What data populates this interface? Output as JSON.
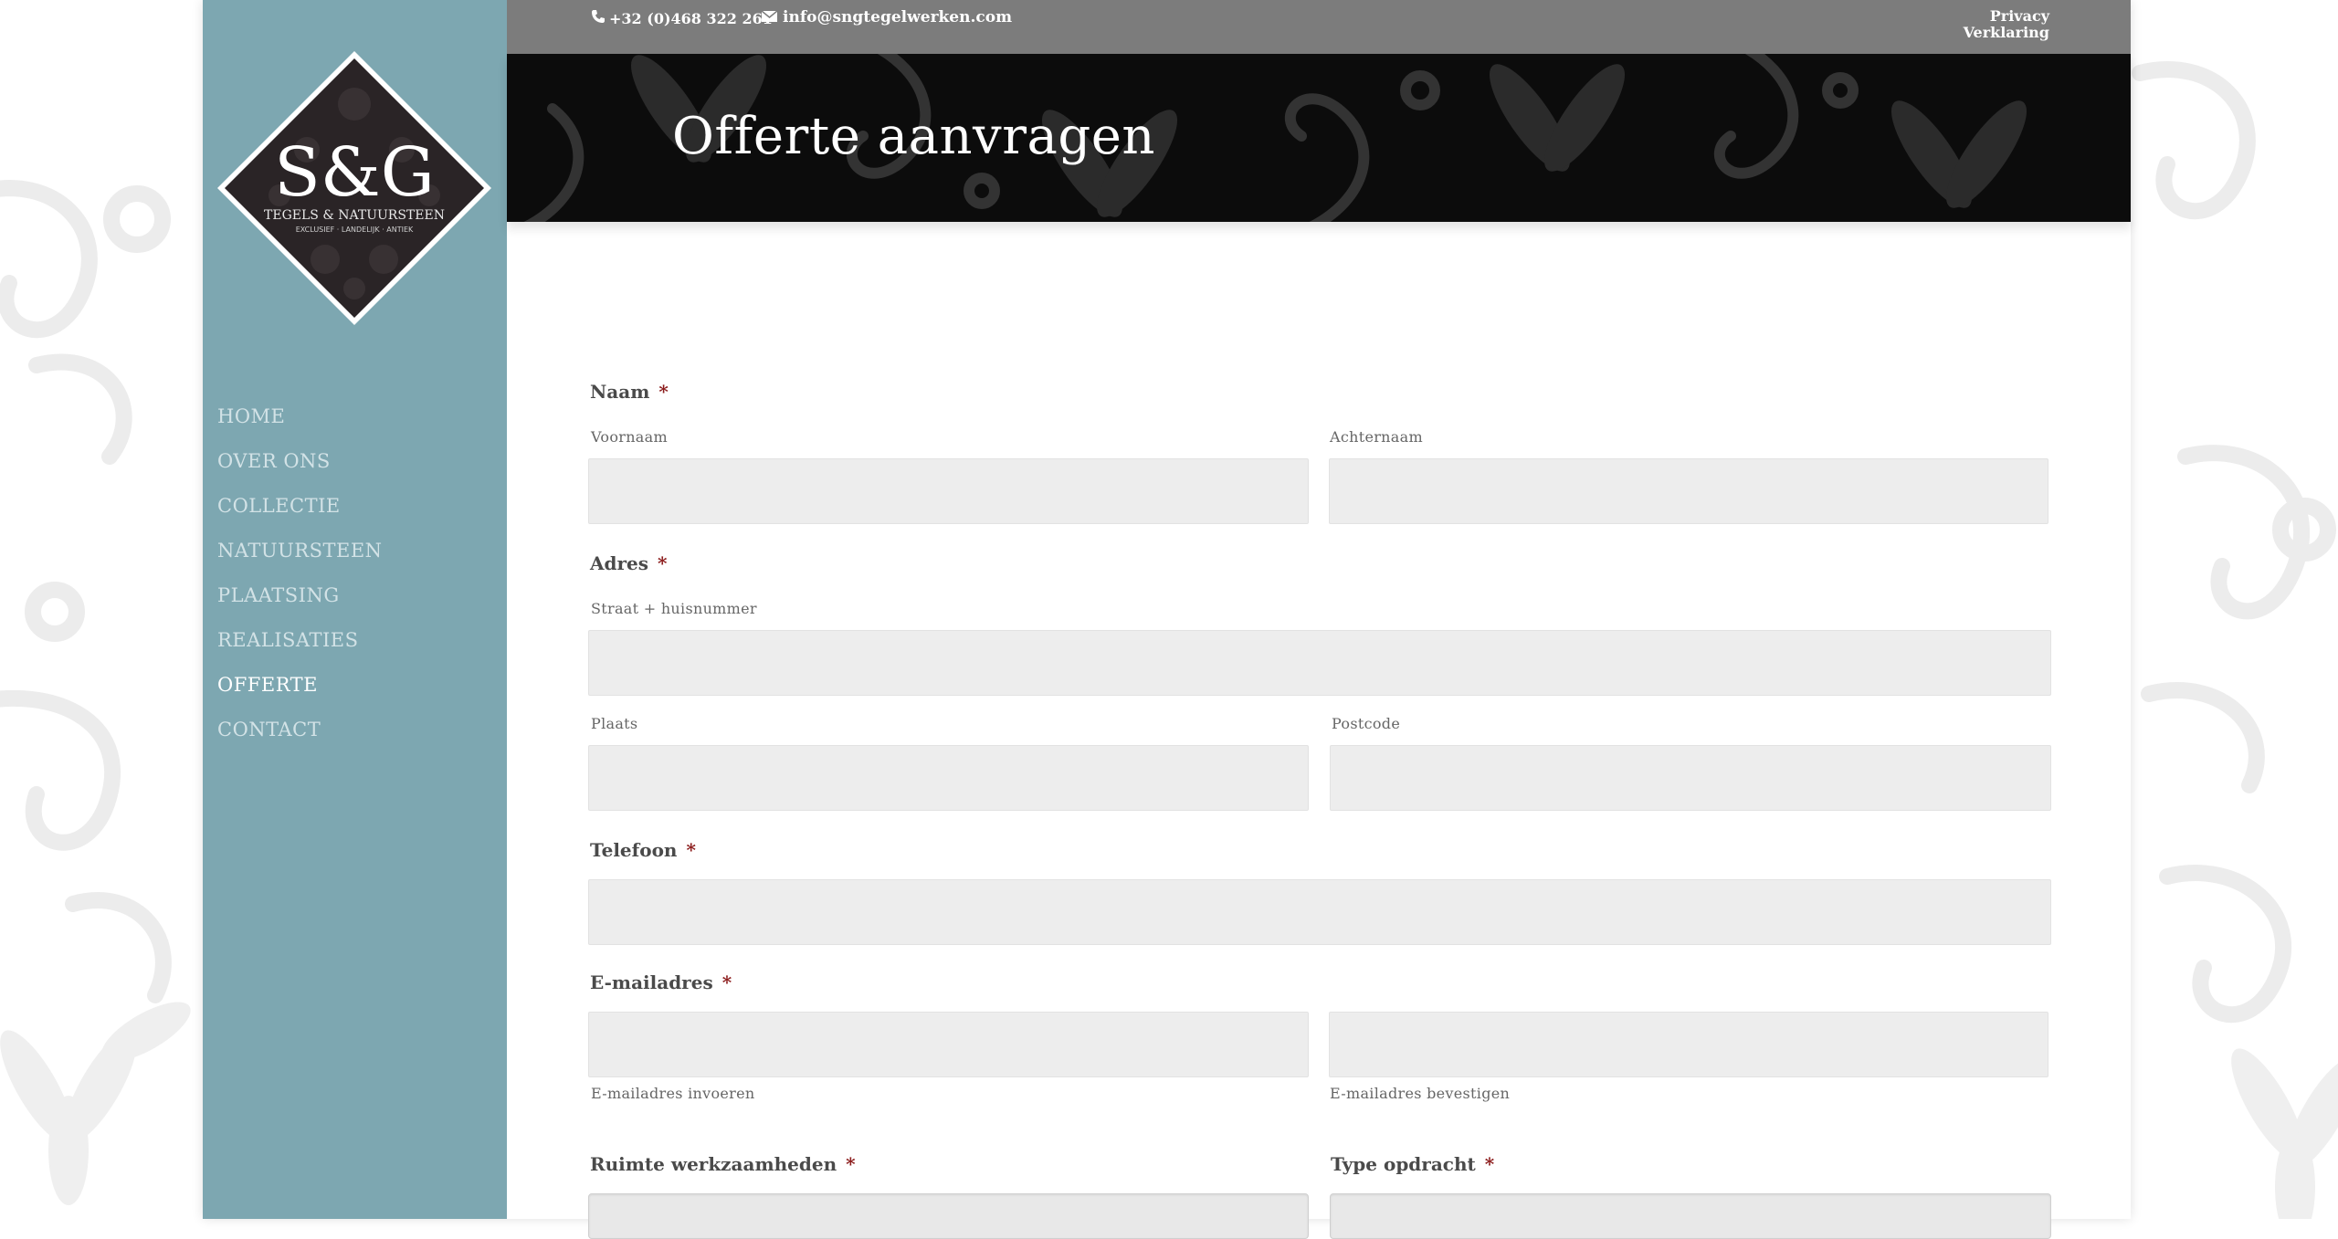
{
  "contact": {
    "phone": "+32 (0)468 322 261",
    "email": "info@sngtegelwerken.com",
    "privacy_line1": "Privacy",
    "privacy_line2": "Verklaring"
  },
  "logo": {
    "monogram": "S&G",
    "tagline": "TEGELS & NATUURSTEEN",
    "subtag": "EXCLUSIEF · LANDELIJK · ANTIEK"
  },
  "nav": [
    {
      "label": "HOME",
      "active": false
    },
    {
      "label": "OVER ONS",
      "active": false
    },
    {
      "label": "COLLECTIE",
      "active": false
    },
    {
      "label": "NATUURSTEEN",
      "active": false
    },
    {
      "label": "PLAATSING",
      "active": false
    },
    {
      "label": "REALISATIES",
      "active": false
    },
    {
      "label": "OFFERTE",
      "active": true
    },
    {
      "label": "CONTACT",
      "active": false
    }
  ],
  "page_title": "Offerte aanvragen",
  "form": {
    "naam": {
      "label": "Naam",
      "required": "*",
      "first_sub": "Voornaam",
      "last_sub": "Achternaam",
      "first_value": "",
      "last_value": ""
    },
    "adres": {
      "label": "Adres",
      "required": "*",
      "street_sub": "Straat + huisnummer",
      "city_sub": "Plaats",
      "postcode_sub": "Postcode",
      "street_value": "",
      "city_value": "",
      "postcode_value": ""
    },
    "telefoon": {
      "label": "Telefoon",
      "required": "*",
      "value": ""
    },
    "email": {
      "label": "E-mailadres",
      "required": "*",
      "enter_sub": "E-mailadres invoeren",
      "confirm_sub": "E-mailadres bevestigen",
      "enter_value": "",
      "confirm_value": ""
    },
    "ruimte": {
      "label": "Ruimte werkzaamheden",
      "required": "*"
    },
    "type": {
      "label": "Type opdracht",
      "required": "*"
    }
  },
  "colors": {
    "sidebar": "#7da7b1",
    "topbar": "#7c7c7c",
    "hero": "#0c0c0c",
    "field": "#ededed",
    "required": "#8b1a1a"
  }
}
